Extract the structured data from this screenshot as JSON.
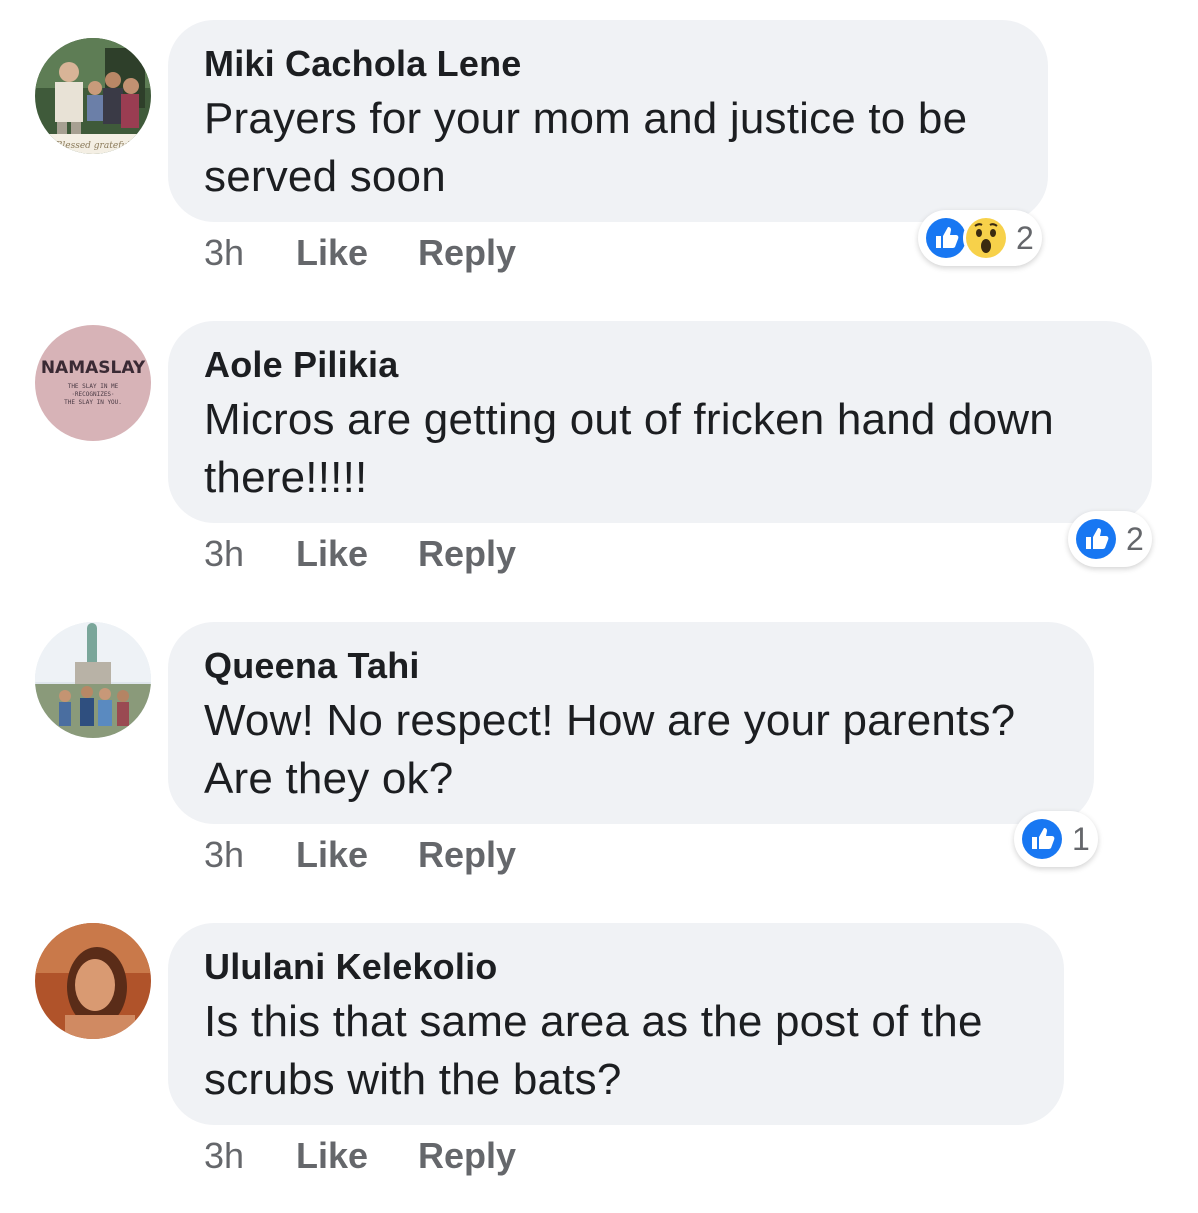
{
  "comments": [
    {
      "author": "Miki Cachola Lene",
      "text_lines": [
        "Prayers for your mom and justice to be",
        "served soon"
      ],
      "avatar_caption": "Blessed grateful",
      "time": "3h",
      "like_label": "Like",
      "reply_label": "Reply",
      "reactions": [
        "like-icon",
        "wow-icon"
      ],
      "reaction_count": "2"
    },
    {
      "author": "Aole Pilikia",
      "text_lines": [
        "Micros are getting out of fricken hand down",
        "there!!!!!"
      ],
      "avatar_title": "NAMASLAY",
      "avatar_caption_lines": [
        "THE SLAY IN ME",
        "·RECOGNIZES·",
        "THE SLAY IN YOU."
      ],
      "time": "3h",
      "like_label": "Like",
      "reply_label": "Reply",
      "reactions": [
        "like-icon"
      ],
      "reaction_count": "2"
    },
    {
      "author": "Queena Tahi",
      "text_lines": [
        "Wow! No respect! How are your parents?",
        "Are they ok?"
      ],
      "time": "3h",
      "like_label": "Like",
      "reply_label": "Reply",
      "reactions": [
        "like-icon"
      ],
      "reaction_count": "1"
    },
    {
      "author": "Ululani Kelekolio",
      "text_lines": [
        "Is this that same area as the post of the",
        "scrubs with the bats?"
      ],
      "time": "3h",
      "like_label": "Like",
      "reply_label": "Reply"
    }
  ],
  "colors": {
    "bubble": "#f0f2f5",
    "text": "#1c1e21",
    "secondary_text": "#65676b",
    "like_blue": "#1877f2",
    "wow_yellow": "#f7d14a"
  }
}
